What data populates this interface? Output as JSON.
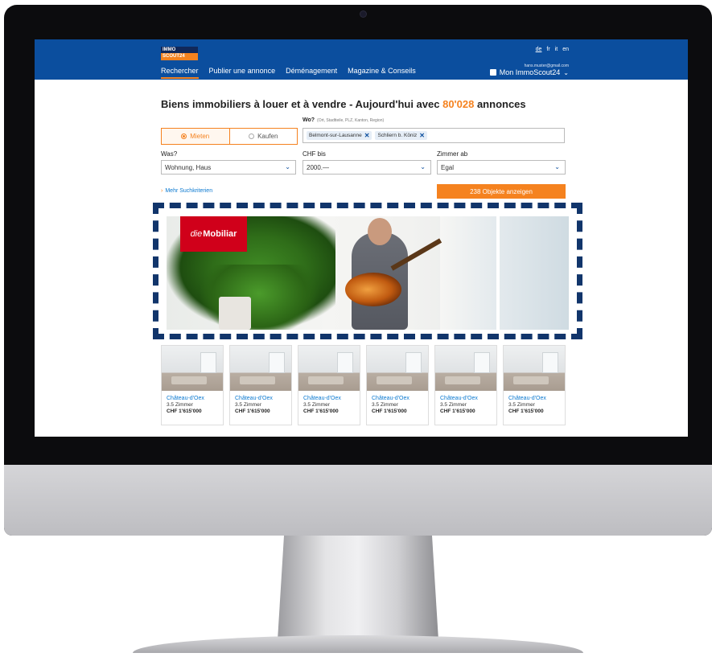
{
  "header": {
    "logo_top": "IMMO",
    "logo_bottom": "SCOUT24",
    "languages": [
      "de",
      "fr",
      "it",
      "en"
    ],
    "active_language": "de",
    "user_email": "hans.muster@gmail.com",
    "account_label": "Mon ImmoScout24",
    "nav": [
      "Rechercher",
      "Publier une annonce",
      "Déménagement",
      "Magazine & Conseils"
    ],
    "nav_selected": "Rechercher"
  },
  "search": {
    "headline_before": "Biens immobiliers à louer et à vendre - Aujourd'hui avec ",
    "headline_count": "80'028",
    "headline_after": " annonces",
    "mode_options": [
      "Mieten",
      "Kaufen"
    ],
    "mode_selected": "Mieten",
    "location_label": "Wo?",
    "location_hint": "(Ort, Stadtteile, PLZ, Kanton, Region)",
    "location_chips": [
      "Belmont-sur-Lausanne",
      "Schliern b. Köniz"
    ],
    "type_label": "Was?",
    "type_value": "Wohnung, Haus",
    "price_label": "CHF bis",
    "price_value": "2000.—",
    "rooms_label": "Zimmer ab",
    "rooms_value": "Egal",
    "more_criteria": "Mehr Suchkriterien",
    "submit_label": "238 Objekte anzeigen"
  },
  "banner": {
    "brand_prefix": "die",
    "brand_name": "Mobiliar"
  },
  "listings": [
    {
      "city": "Château-d'Oex",
      "rooms": "3.5 Zimmer",
      "price": "CHF 1'615'000"
    },
    {
      "city": "Château-d'Oex",
      "rooms": "3.5 Zimmer",
      "price": "CHF 1'615'000"
    },
    {
      "city": "Château-d'Oex",
      "rooms": "3.5 Zimmer",
      "price": "CHF 1'615'000"
    },
    {
      "city": "Château-d'Oex",
      "rooms": "3.5 Zimmer",
      "price": "CHF 1'615'000"
    },
    {
      "city": "Château-d'Oex",
      "rooms": "3.5 Zimmer",
      "price": "CHF 1'615'000"
    },
    {
      "city": "Château-d'Oex",
      "rooms": "3.5 Zimmer",
      "price": "CHF 1'615'000"
    }
  ],
  "colors": {
    "brand_blue": "#0b4e9e",
    "accent_orange": "#f5821f",
    "ad_red": "#d0001a"
  }
}
